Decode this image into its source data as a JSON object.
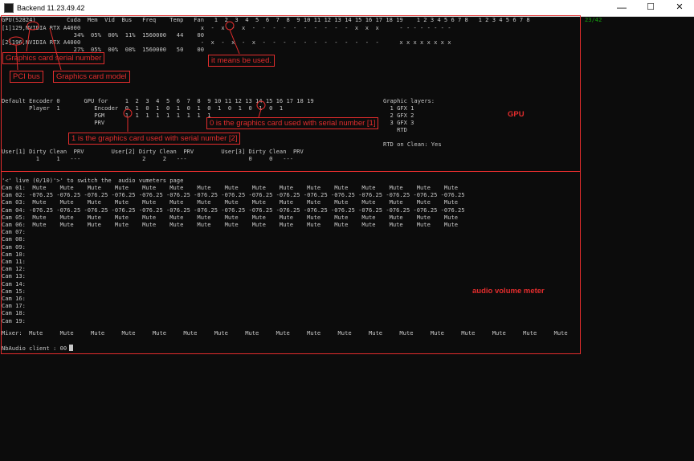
{
  "window": {
    "title": "Backend 11.23.49.42",
    "minimize": "—",
    "maximize": "☐",
    "close": "✕"
  },
  "terminal": {
    "counter": "23/42",
    "gpu_header": "GPU(S2824)         Cuda  Mem  Vid  Bus   Freq    Temp   Fan   1  2  3  4  5  6  7  8  9 10 11 12 13 14 15 16 17 18 19    1 2 3 4 5 6 7 8   1 2 3 4 5 6 7 8",
    "gpu1_name": "[1]129,NVIDIA RTX A4000",
    "gpu1_usage": "                                                          x  -  x  -  x  -  -  -  -  -  -  -  -  -  -  x  x  x      - - - - - - - -",
    "gpu1_stats": "                     34%  05%  00%  11%  1560000   44    00",
    "gpu2_name": "[2]196,NVIDIA RTX A4000",
    "gpu2_usage": "                                                          -  x  -  x  -  x  -  -  -  -  -  -  -  -  -  -  -  -      x x x x x x x x",
    "gpu2_stats": "                     27%  05%  00%  08%  1560000   50    00",
    "enc_header": "Default Encoder 0       GPU for     1  2  3  4  5  6  7  8  9 10 11 12 13 14 15 16 17 18 19",
    "enc_player": "        Player  1          Encoder  0  1  0  1  0  1  0  1  0  1  0  1  0  1  0  1",
    "enc_pgm": "                           PGM      1  1  1  1  1  1  1  1  1",
    "enc_prv": "                           PRV",
    "gfx_header": "Graphic layers:",
    "gfx_1": "  1 GFX 1",
    "gfx_2": "  2 GFX 2",
    "gfx_3": "  3 GFX 3",
    "gfx_rtd": "    RTD",
    "rtd_clean": "RTD on Clean: Yes",
    "user_header": "User[1] Dirty Clean  PRV        User[2] Dirty Clean  PRV        User[3] Dirty Clean  PRV",
    "user_values": "          1     1   ---                  2     2   ---                  0     0   ---",
    "vu_hint": "'<' live (0/10)'>' to switch the  audio vumeters page",
    "cams": [
      "Cam 01:  Mute    Mute    Mute    Mute    Mute    Mute    Mute    Mute    Mute    Mute    Mute    Mute    Mute    Mute    Mute    Mute",
      "Cam 02: -076.25 -076.25 -076.25 -076.25 -076.25 -076.25 -076.25 -076.25 -076.25 -076.25 -076.25 -076.25 -076.25 -076.25 -076.25 -076.25",
      "Cam 03:  Mute    Mute    Mute    Mute    Mute    Mute    Mute    Mute    Mute    Mute    Mute    Mute    Mute    Mute    Mute    Mute",
      "Cam 04: -076.25 -076.25 -076.25 -076.25 -076.25 -076.25 -076.25 -076.25 -076.25 -076.25 -076.25 -076.25 -076.25 -076.25 -076.25 -076.25",
      "Cam 05:  Mute    Mute    Mute    Mute    Mute    Mute    Mute    Mute    Mute    Mute    Mute    Mute    Mute    Mute    Mute    Mute",
      "Cam 06:  Mute    Mute    Mute    Mute    Mute    Mute    Mute    Mute    Mute    Mute    Mute    Mute    Mute    Mute    Mute    Mute",
      "Cam 07:",
      "Cam 08:",
      "Cam 09:",
      "Cam 10:",
      "Cam 11:",
      "Cam 12:",
      "Cam 13:",
      "Cam 14:",
      "Cam 15:",
      "Cam 16:",
      "Cam 17:",
      "Cam 18:",
      "Cam 19:"
    ],
    "mixer": "Mixer:  Mute     Mute     Mute     Mute     Mute     Mute     Mute     Mute     Mute     Mute     Mute     Mute     Mute     Mute     Mute     Mute     Mute     Mute",
    "nbaudio": "NbAudio client : 00"
  },
  "annotations": {
    "serial_label": "Graphics card serial number",
    "pci_label": "PCI bus",
    "model_label": "Graphics card model",
    "used_label": "it means be used.",
    "serial1_label": "0 is the graphics card used with serial number [1]",
    "serial2_label": "1 is the graphics card used with serial number [2]",
    "gpu_section": "GPU",
    "audio_section": "audio volume meter"
  },
  "colors": {
    "annotation": "#e32d2d",
    "counter": "#13a10e",
    "terminal_bg": "#0c0c0c",
    "terminal_fg": "#c8c8c8"
  }
}
